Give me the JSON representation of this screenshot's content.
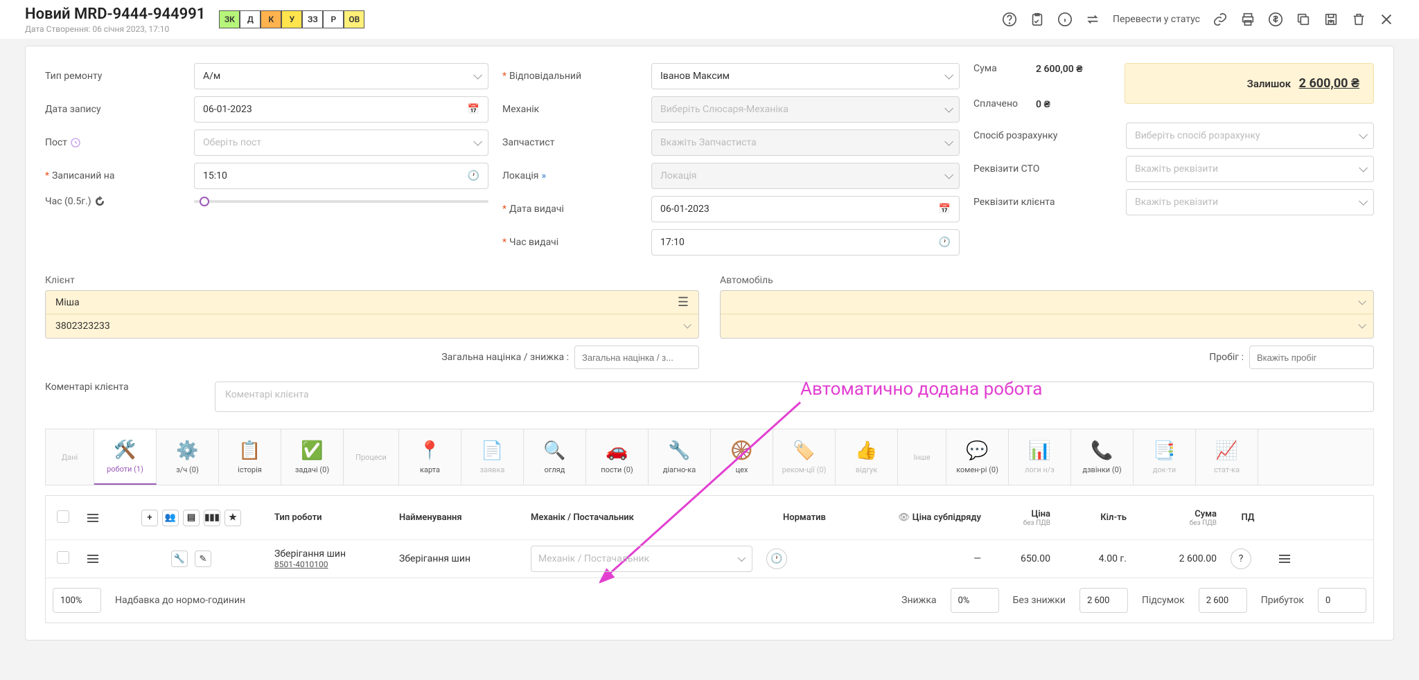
{
  "header": {
    "title": "Новий MRD-9444-944991",
    "subtitle": "Дата Створення: 06 січня 2023, 17:10",
    "status_pills": [
      "ЗК",
      "Д",
      "К",
      "У",
      "ЗЗ",
      "Р",
      "ОВ"
    ],
    "status_action_label": "Перевести у статус"
  },
  "form": {
    "repair_type_label": "Тип ремонту",
    "repair_type_value": "А/м",
    "record_date_label": "Дата запису",
    "record_date_value": "06-01-2023",
    "post_label": "Пост",
    "post_placeholder": "Оберіть пост",
    "booked_for_label": "Записаний на",
    "booked_for_value": "15:10",
    "time_label": "Час (0.5г.)",
    "responsible_label": "Відповідальний",
    "responsible_value": "Іванов Максим",
    "mechanic_label": "Механік",
    "mechanic_placeholder": "Виберіть Слюсаря-Механіка",
    "parts_label": "Запчастист",
    "parts_placeholder": "Вкажіть Запчастиста",
    "location_label": "Локація",
    "location_placeholder": "Локація",
    "issue_date_label": "Дата видачі",
    "issue_date_value": "06-01-2023",
    "issue_time_label": "Час видачі",
    "issue_time_value": "17:10",
    "sum_label": "Сума",
    "sum_value": "2 600,00 ₴",
    "paid_label": "Сплачено",
    "paid_value": "0 ₴",
    "remainder_label": "Залишок",
    "remainder_value": "2 600,00 ₴",
    "payment_method_label": "Спосіб розрахунку",
    "payment_method_placeholder": "Виберіть спосіб розрахунку",
    "sto_req_label": "Реквізити СТО",
    "sto_req_placeholder": "Вкажіть реквізити",
    "client_req_label": "Реквізити клієнта",
    "client_req_placeholder": "Вкажіть реквізити"
  },
  "client": {
    "heading": "Клієнт",
    "name": "Міша",
    "phone": "3802323233"
  },
  "auto": {
    "heading": "Автомобіль"
  },
  "discount_label": "Загальна націнка / знижка :",
  "discount_placeholder": "Загальна націнка / з...",
  "mileage_label": "Пробіг :",
  "mileage_placeholder": "Вкажіть пробіг",
  "comment_label": "Коментарі клієнта",
  "comment_placeholder": "Коментарі клієнта",
  "annotation": {
    "text": "Автоматично додана робота"
  },
  "tabs": {
    "data": "Дані",
    "works": "роботи (1)",
    "parts": "з/ч (0)",
    "history": "історія",
    "tasks": "задачі (0)",
    "processes": "Процеси",
    "map": "карта",
    "request": "заявка",
    "inspection": "огляд",
    "posts": "пости (0)",
    "diag": "діагно-ка",
    "workshop": "цех",
    "recom": "реком-ції (0)",
    "feedback": "відгук",
    "other": "Інше",
    "comments": "комен-рі (0)",
    "logs": "логи н/з",
    "calls": "дзвінки (0)",
    "docs": "док-ти",
    "stats": "стат-ка"
  },
  "table": {
    "h_type": "Тип роботи",
    "h_name": "Найменування",
    "h_mech": "Механік / Постачальник",
    "h_norm": "Норматив",
    "h_sub": "Ціна субпідряду",
    "h_price": "Ціна",
    "h_novat": "без ПДВ",
    "h_qty": "Кіл-ть",
    "h_sum": "Сума",
    "h_vat": "ПД",
    "row": {
      "type": "Зберігання шин",
      "code": "8501-4010100",
      "name": "Зберігання шин",
      "mech_placeholder": "Механік / Постачальник",
      "sub": "—",
      "price": "650.00",
      "qty": "4.00 г.",
      "sum": "2 600.00"
    }
  },
  "footer": {
    "percent": "100%",
    "percent_label": "Надбавка до нормо-годинин",
    "discount_label": "Знижка",
    "discount_val": "0%",
    "nodisc_label": "Без знижки",
    "nodisc_val": "2 600",
    "subtotal_label": "Підсумок",
    "subtotal_val": "2 600",
    "profit_label": "Прибуток",
    "profit_val": "0"
  }
}
